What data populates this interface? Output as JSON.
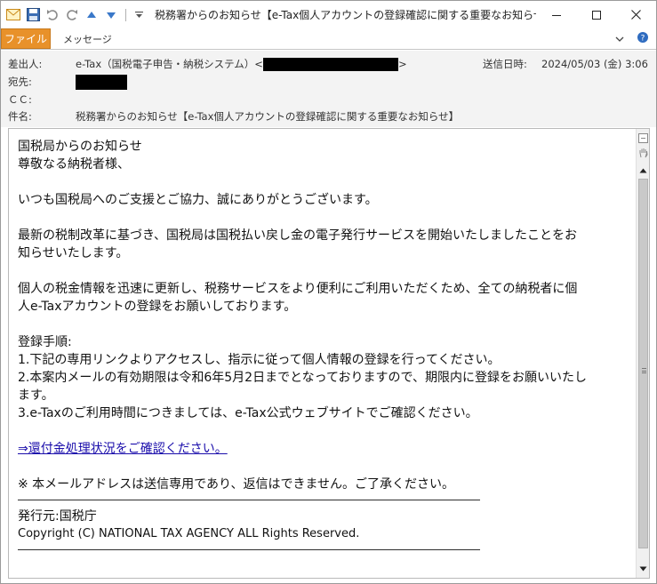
{
  "window": {
    "title": "税務署からのお知らせ【e-Tax個人アカウントの登録確認に関する重要なお知らせ】 - メ",
    "controls": {
      "minimize": "—",
      "maximize": "☐",
      "close": "✕"
    }
  },
  "ribbon": {
    "file_tab": "ファイル",
    "message_tab": "メッセージ"
  },
  "header": {
    "from_label": "差出人:",
    "from_value": "e-Tax（国税電子申告・納税システム）<",
    "from_end": ">",
    "to_label": "宛先:",
    "cc_label": "ＣＣ:",
    "subject_label": "件名:",
    "subject_value": "税務署からのお知らせ【e-Tax個人アカウントの登録確認に関する重要なお知らせ】",
    "sent_label": "送信日時:",
    "sent_value": "2024/05/03 (金) 3:06"
  },
  "body": {
    "line1": "国税局からのお知らせ",
    "line2": "尊敬なる納税者様、",
    "para1": "いつも国税局へのご支援とご協力、誠にありがとうございます。",
    "para2a": "最新の税制改革に基づき、国税局は国税払い戻し金の電子発行サービスを開始いたしましたことをお",
    "para2b": "知らせいたします。",
    "para3a": "個人の税金情報を迅速に更新し、税務サービスをより便利にご利用いただくため、全ての納税者に個",
    "para3b": "人e-Taxアカウントの登録をお願いしております。",
    "steps_title": "登録手順:",
    "step1": "1.下記の専用リンクよりアクセスし、指示に従って個人情報の登録を行ってください。",
    "step2a": "2.本案内メールの有効期限は令和6年5月2日までとなっておりますので、期限内に登録をお願いいたし",
    "step2b": "ます。",
    "step3": "3.e-Taxのご利用時間につきましては、e-Tax公式ウェブサイトでご確認ください。",
    "link": "⇒還付金処理状況をご確認ください。",
    "notice": "※ 本メールアドレスは送信専用であり、返信はできません。ご了承ください。",
    "rule": "――――――――――――――――――――――――――――――――――――――――",
    "issuer": "発行元:国税庁",
    "copyright": "Copyright (C) NATIONAL TAX AGENCY ALL Rights Reserved.",
    "rule2": "――――――――――――――――――――――――――――――――――――――――"
  },
  "colors": {
    "file_tab": "#e8912a",
    "link": "#1a0dab",
    "redaction": "#000000"
  }
}
